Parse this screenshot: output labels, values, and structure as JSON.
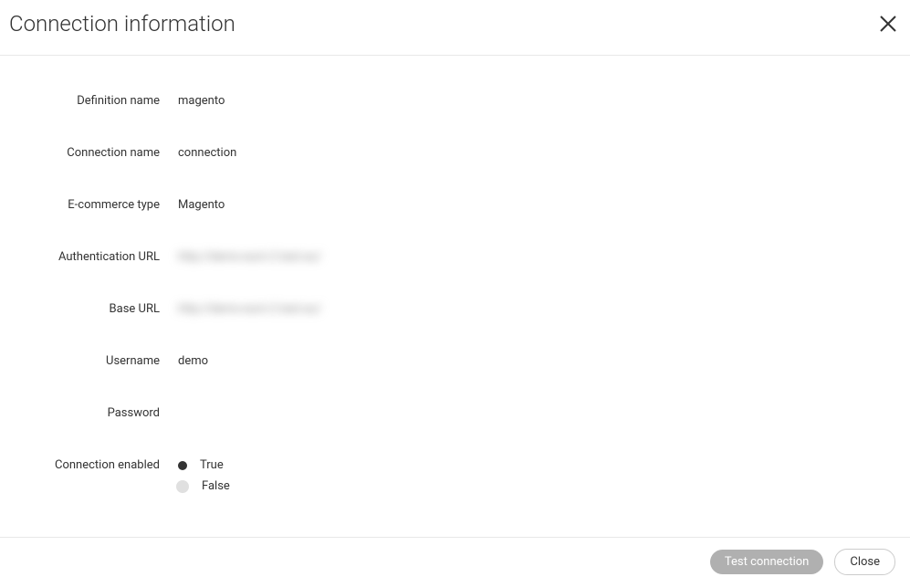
{
  "header": {
    "title": "Connection information"
  },
  "fields": {
    "definition_name": {
      "label": "Definition name",
      "value": "magento"
    },
    "connection_name": {
      "label": "Connection name",
      "value": "connection"
    },
    "ecommerce_type": {
      "label": "E-commerce type",
      "value": "Magento"
    },
    "authentication_url": {
      "label": "Authentication URL",
      "value": "http://demo-eurn-2.test.eu/"
    },
    "base_url": {
      "label": "Base URL",
      "value": "http://demo-eurn-2.test.eu/"
    },
    "username": {
      "label": "Username",
      "value": "demo"
    },
    "password": {
      "label": "Password",
      "value": ""
    },
    "connection_enabled": {
      "label": "Connection enabled",
      "options": {
        "true_label": "True",
        "false_label": "False"
      },
      "selected": "true"
    }
  },
  "footer": {
    "test_connection": "Test connection",
    "close": "Close"
  }
}
